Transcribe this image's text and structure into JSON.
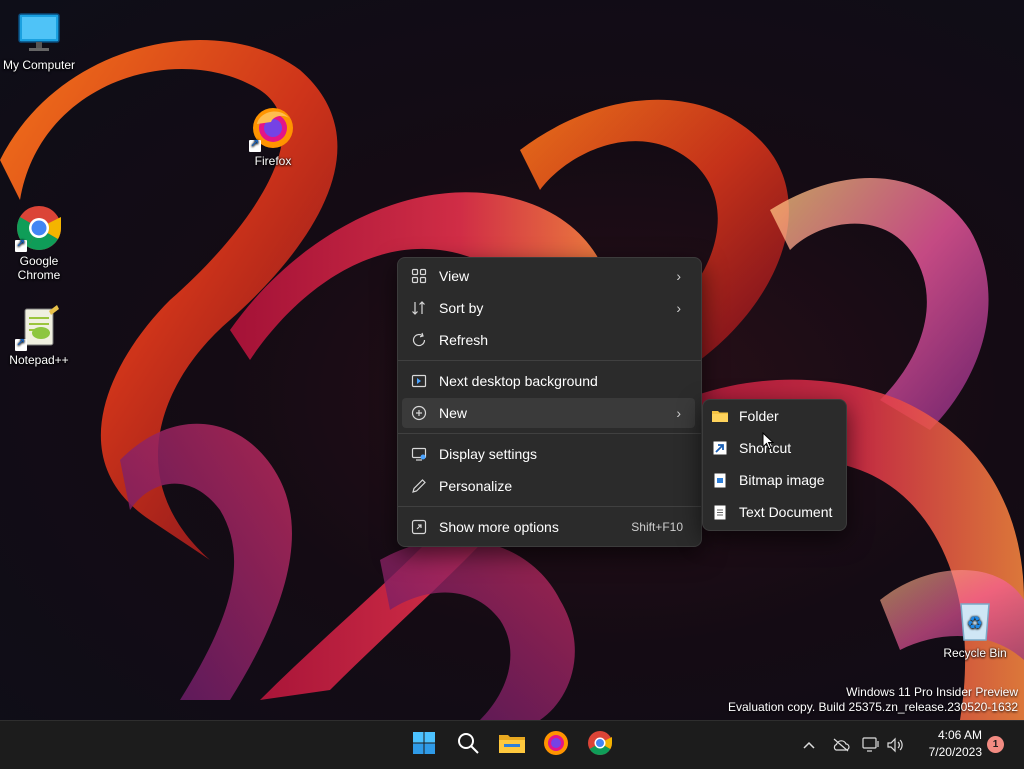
{
  "desktop": {
    "icons": [
      {
        "label": "My Computer"
      },
      {
        "label": "Firefox"
      },
      {
        "label": "Google Chrome"
      },
      {
        "label": "Notepad++"
      },
      {
        "label": "Recycle Bin"
      }
    ]
  },
  "context_menu": {
    "items": [
      {
        "label": "View",
        "icon": "grid-icon",
        "has_submenu": true
      },
      {
        "label": "Sort by",
        "icon": "sort-icon",
        "has_submenu": true
      },
      {
        "label": "Refresh",
        "icon": "refresh-icon"
      },
      {
        "label": "Next desktop background",
        "icon": "next-background-icon"
      },
      {
        "label": "New",
        "icon": "new-plus-icon",
        "has_submenu": true,
        "highlighted": true
      },
      {
        "label": "Display settings",
        "icon": "display-icon"
      },
      {
        "label": "Personalize",
        "icon": "pen-icon"
      },
      {
        "label": "Show more options",
        "icon": "more-options-icon",
        "shortcut": "Shift+F10"
      }
    ]
  },
  "new_submenu": {
    "items": [
      {
        "label": "Folder",
        "icon": "folder-icon"
      },
      {
        "label": "Shortcut",
        "icon": "shortcut-icon"
      },
      {
        "label": "Bitmap image",
        "icon": "bitmap-icon"
      },
      {
        "label": "Text Document",
        "icon": "text-document-icon"
      }
    ]
  },
  "watermark": {
    "line1": "Windows 11 Pro Insider Preview",
    "line2": "Evaluation copy. Build 25375.zn_release.230520-1632"
  },
  "taskbar": {
    "apps": [
      "start-icon",
      "search-icon",
      "file-explorer-icon",
      "firefox-icon",
      "chrome-icon"
    ],
    "time": "4:06 AM",
    "date": "7/20/2023",
    "notification_count": "1"
  },
  "colors": {
    "menu_bg": "#2b2b2b",
    "taskbar_bg": "#1c1c1c",
    "accent": "#0078d4"
  }
}
